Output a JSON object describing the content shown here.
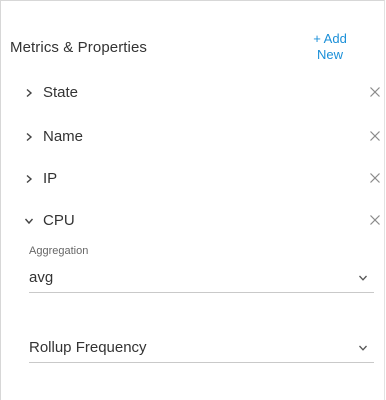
{
  "panel": {
    "title": "Metrics & Properties",
    "add_new_line1": "+ Add",
    "add_new_line2": "New"
  },
  "items": [
    {
      "label": "State",
      "expanded": false
    },
    {
      "label": "Name",
      "expanded": false
    },
    {
      "label": "IP",
      "expanded": false
    },
    {
      "label": "CPU",
      "expanded": true
    }
  ],
  "cpu_settings": {
    "aggregation_label": "Aggregation",
    "aggregation_value": "avg",
    "rollup_placeholder": "Rollup Frequency"
  },
  "colors": {
    "accent": "#1a8fd8",
    "text": "#333333",
    "icon": "#8a8a8a"
  },
  "icons": {
    "collapsed": "chevron-right-icon",
    "expanded": "chevron-down-icon",
    "remove": "close-icon",
    "dropdown": "caret-down-icon"
  }
}
